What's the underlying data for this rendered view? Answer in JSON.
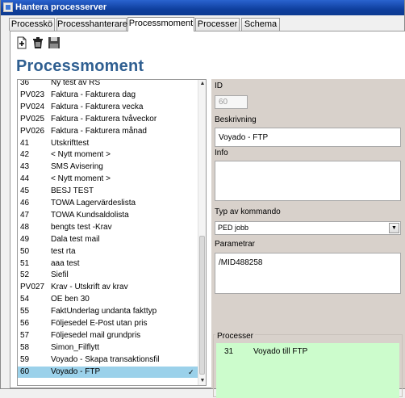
{
  "window": {
    "title": "Hantera processerver"
  },
  "tabs": [
    {
      "label": "Processkö"
    },
    {
      "label": "Processhanterare"
    },
    {
      "label": "Processmoment"
    },
    {
      "label": "Processer"
    },
    {
      "label": "Schema"
    }
  ],
  "toolbar": {
    "new_icon": "new-icon",
    "delete_icon": "trash-icon",
    "save_icon": "floppy-icon"
  },
  "heading": "Processmoment",
  "list": {
    "rows": [
      {
        "id": "36",
        "name": "Ny test av RS"
      },
      {
        "id": "PV023",
        "name": "Faktura - Fakturera dag"
      },
      {
        "id": "PV024",
        "name": "Faktura - Fakturera vecka"
      },
      {
        "id": "PV025",
        "name": "Faktura - Fakturera tvåveckor"
      },
      {
        "id": "PV026",
        "name": "Faktura - Fakturera månad"
      },
      {
        "id": "41",
        "name": "Utskrifttest"
      },
      {
        "id": "42",
        "name": "< Nytt moment >"
      },
      {
        "id": "43",
        "name": "SMS Avisering"
      },
      {
        "id": "44",
        "name": "< Nytt moment >"
      },
      {
        "id": "45",
        "name": "BESJ TEST"
      },
      {
        "id": "46",
        "name": "TOWA Lagervärdeslista"
      },
      {
        "id": "47",
        "name": "TOWA Kundsaldolista"
      },
      {
        "id": "48",
        "name": "bengts test -Krav"
      },
      {
        "id": "49",
        "name": "Dala test mail"
      },
      {
        "id": "50",
        "name": "test rta"
      },
      {
        "id": "51",
        "name": "aaa test"
      },
      {
        "id": "52",
        "name": "Siefil"
      },
      {
        "id": "PV027",
        "name": "Krav - Utskrift av krav"
      },
      {
        "id": "54",
        "name": "OE ben 30"
      },
      {
        "id": "55",
        "name": "FaktUnderlag undanta fakttyp"
      },
      {
        "id": "56",
        "name": "Följesedel E-Post utan pris"
      },
      {
        "id": "57",
        "name": "Följesedel mail grundpris"
      },
      {
        "id": "58",
        "name": "Simon_Filflytt"
      },
      {
        "id": "59",
        "name": "Voyado - Skapa transaktionsfil"
      },
      {
        "id": "60",
        "name": "Voyado - FTP"
      }
    ],
    "selected_index": 24,
    "selected_mark": "✓"
  },
  "detail": {
    "id_label": "ID",
    "id_value": "60",
    "desc_label": "Beskrivning",
    "desc_value": "Voyado - FTP",
    "info_label": "Info",
    "info_value": "",
    "cmd_label": "Typ av kommando",
    "cmd_value": "PED jobb",
    "param_label": "Parametrar",
    "param_value": "/MID488258",
    "proc_label": "Processer",
    "processes": [
      {
        "id": "31",
        "name": "Voyado till FTP"
      }
    ]
  },
  "colors": {
    "selection": "#9bd1ea",
    "heading": "#2f5f91",
    "panel": "#d8d1cb",
    "processes_bg": "#ccfccc"
  }
}
